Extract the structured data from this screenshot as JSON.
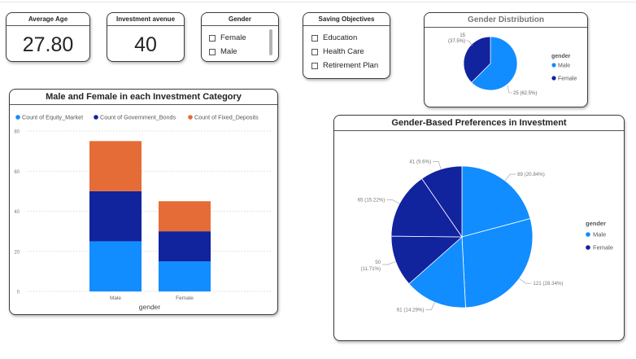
{
  "kpis": {
    "avg_age": {
      "title": "Average Age",
      "value": "27.80"
    },
    "investment_avenue": {
      "title": "Investment avenue",
      "value": "40"
    }
  },
  "gender_slicer": {
    "title": "Gender",
    "items": [
      "Female",
      "Male"
    ]
  },
  "saving_slicer": {
    "title": "Saving Objectives",
    "items": [
      "Education",
      "Health Care",
      "Retirement Plan"
    ]
  },
  "colors": {
    "male": "#118dff",
    "female": "#12239e",
    "fixed": "#e66c37"
  },
  "chart_data": [
    {
      "type": "pie",
      "title": "Gender Distribution",
      "legend_title": "gender",
      "legend_position": "right",
      "slices": [
        {
          "label": "Male",
          "value": 25,
          "data_label": "25 (62.5%)"
        },
        {
          "label": "Female",
          "value": 15,
          "data_label": "15 (37.5%)"
        }
      ]
    },
    {
      "type": "bar",
      "stacked": true,
      "title": "Male and Female in each Investment Category",
      "xlabel": "gender",
      "categories": [
        "Male",
        "Female"
      ],
      "series": [
        {
          "name": "Count of Equity_Market",
          "values": [
            25,
            15
          ]
        },
        {
          "name": "Count of Government_Bonds",
          "values": [
            25,
            15
          ]
        },
        {
          "name": "Count of Fixed_Deposits",
          "values": [
            25,
            15
          ]
        }
      ],
      "ylim": [
        0,
        80
      ],
      "yticks": [
        0,
        20,
        40,
        60,
        80
      ],
      "grid": true,
      "legend_position": "top-left"
    },
    {
      "type": "pie",
      "title": "Gender-Based Preferences in Investment",
      "legend_title": "gender",
      "legend_position": "right",
      "slices": [
        {
          "value": 89,
          "data_label": "89 (20.84%)",
          "series": "Male"
        },
        {
          "value": 121,
          "data_label": "121 (28.34%)",
          "series": "Male"
        },
        {
          "value": 61,
          "data_label": "61 (14.29%)",
          "series": "Male"
        },
        {
          "value": 50,
          "data_label": "50 (11.71%)",
          "series": "Female"
        },
        {
          "value": 65,
          "data_label": "65 (15.22%)",
          "series": "Female"
        },
        {
          "value": 41,
          "data_label": "41 (9.6%)",
          "series": "Female"
        }
      ],
      "legend": [
        "Male",
        "Female"
      ]
    }
  ]
}
